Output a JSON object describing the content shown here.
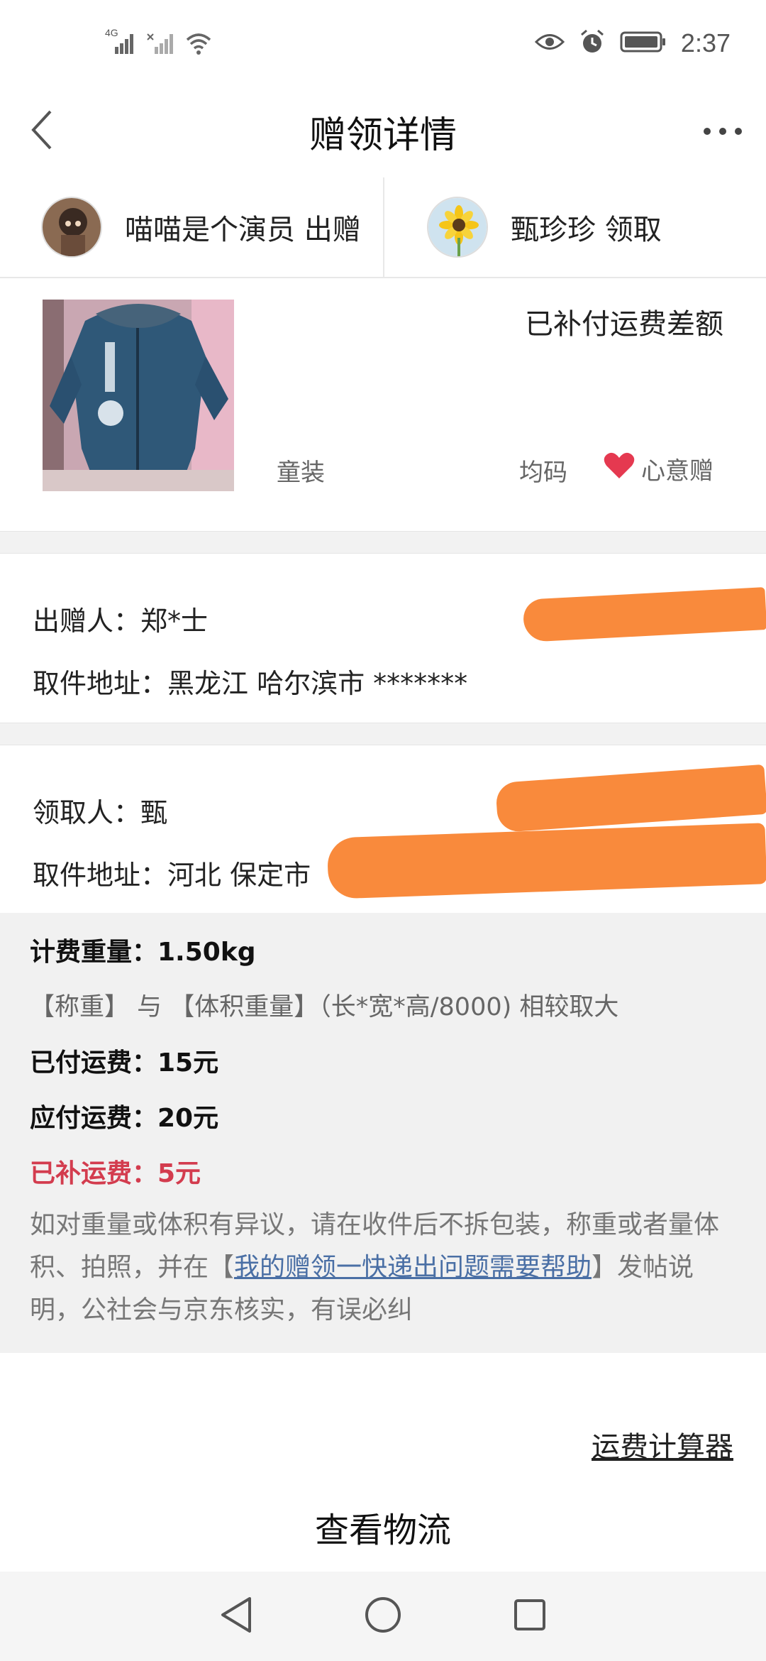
{
  "status_bar": {
    "network_label": "4G",
    "time": "2:37"
  },
  "header": {
    "title": "赠领详情"
  },
  "users": {
    "giver_label": "喵喵是个演员 出赠",
    "receiver_label": "甄珍珍 领取"
  },
  "product": {
    "status": "已补付运费差额",
    "category": "童装",
    "size": "均码",
    "tag": "心意赠"
  },
  "giver_card": {
    "name_label": "出赠人：郑*士",
    "address_label": "取件地址：黑龙江 哈尔滨市 *******"
  },
  "receiver_card": {
    "name_label": "领取人：甄",
    "address_label": "取件地址：河北 保定市"
  },
  "fees": {
    "weight_label": "计费重量：1.50kg",
    "rule_note": "【称重】 与 【体积重量】（长*宽*高/8000) 相较取大",
    "paid_label": "已付运费：15元",
    "due_label": "应付运费：20元",
    "supplement_label": "已补运费：5元",
    "notice_before": "如对重量或体积有异议，请在收件后不拆包装，称重或者量体积、拍照，并在【",
    "notice_link": "我的赠领一快递出问题需要帮助",
    "notice_after": "】发帖说明，公社会与京东核实，有误必纠"
  },
  "actions": {
    "calculator_link": "运费计算器",
    "logistics_button": "查看物流"
  },
  "colors": {
    "accent_red": "#d33c4e",
    "link_blue": "#4a6fa5",
    "redaction_orange": "#f98a3c",
    "heart_red": "#e53950"
  },
  "icons": [
    "back-icon",
    "more-icon",
    "heart-icon",
    "signal-icon",
    "wifi-icon",
    "eye-icon",
    "alarm-icon",
    "battery-icon",
    "nav-back-icon",
    "nav-home-icon",
    "nav-recents-icon"
  ]
}
